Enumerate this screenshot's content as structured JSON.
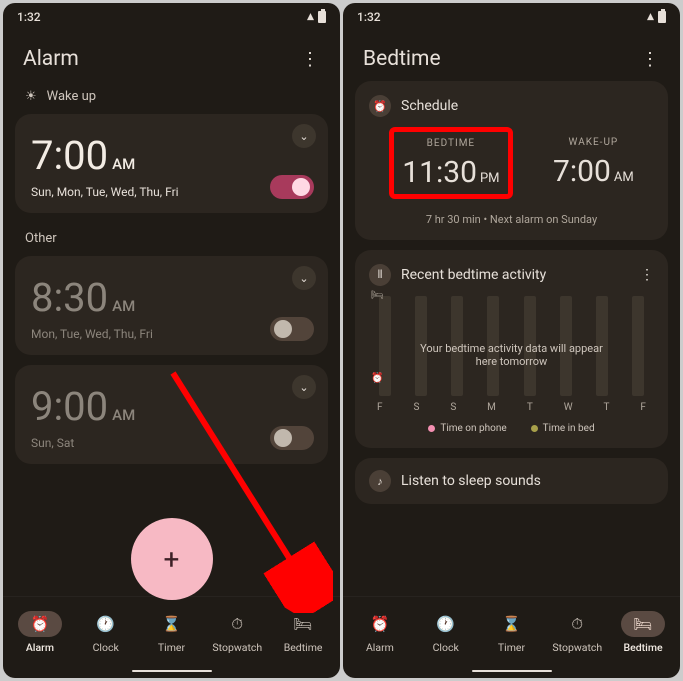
{
  "status": {
    "time": "1:32"
  },
  "left": {
    "title": "Alarm",
    "section1": "Wake up",
    "section2": "Other",
    "alarms": [
      {
        "time": "7:00",
        "ampm": "AM",
        "days": "Sun, Mon, Tue, Wed, Thu, Fri",
        "on": true
      },
      {
        "time": "8:30",
        "ampm": "AM",
        "days": "Mon, Tue, Wed, Thu, Fri",
        "on": false
      },
      {
        "time": "9:00",
        "ampm": "AM",
        "days": "Sun, Sat",
        "on": false
      }
    ]
  },
  "right": {
    "title": "Bedtime",
    "schedule": {
      "heading": "Schedule",
      "bedtime_label": "BEDTIME",
      "bedtime_time": "11:30",
      "bedtime_ampm": "PM",
      "wakeup_label": "WAKE-UP",
      "wakeup_time": "7:00",
      "wakeup_ampm": "AM",
      "info": "7 hr 30 min • Next alarm on Sunday"
    },
    "activity": {
      "heading": "Recent bedtime activity",
      "overlay": "Your bedtime activity data will appear here tomorrow",
      "days": [
        "F",
        "S",
        "S",
        "M",
        "T",
        "W",
        "T",
        "F"
      ],
      "legend1": "Time on phone",
      "legend2": "Time in bed"
    },
    "sleep_sounds": "Listen to sleep sounds"
  },
  "nav": {
    "alarm": "Alarm",
    "clock": "Clock",
    "timer": "Timer",
    "stopwatch": "Stopwatch",
    "bedtime": "Bedtime"
  }
}
